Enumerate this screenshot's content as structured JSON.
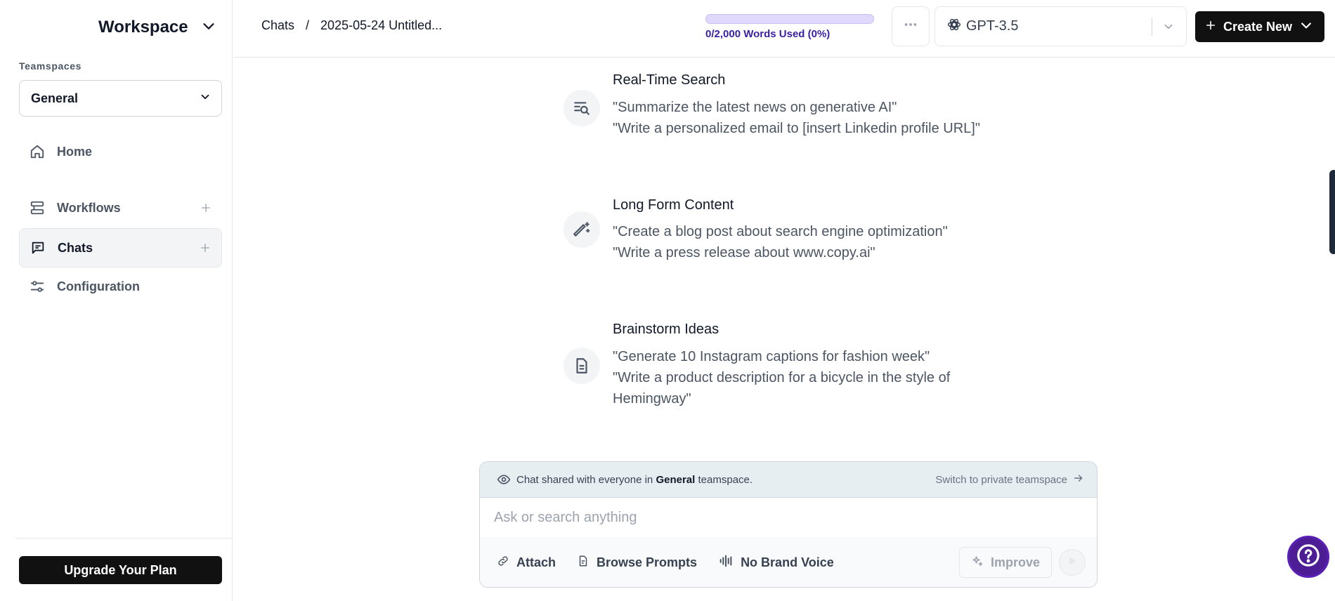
{
  "sidebar": {
    "workspace_name": "Workspace",
    "teamspaces_label": "Teamspaces",
    "teamspace_selected": "General",
    "nav": [
      {
        "label": "Home",
        "icon": "home-icon"
      },
      {
        "label": "Workflows",
        "icon": "workflows-icon"
      },
      {
        "label": "Chats",
        "icon": "chat-icon",
        "active": true
      },
      {
        "label": "Configuration",
        "icon": "sliders-icon"
      }
    ],
    "upgrade_label": "Upgrade Your Plan"
  },
  "header": {
    "breadcrumb": {
      "root": "Chats",
      "separator": "/",
      "current": "2025-05-24 Untitled..."
    },
    "usage": {
      "text": "0/2,000 Words Used (0%)",
      "percent": 0
    },
    "more_icon": "ellipsis-icon",
    "model": {
      "icon": "openai-logo-icon",
      "name": "GPT-3.5"
    },
    "create_label": "Create New"
  },
  "prompt_groups": [
    {
      "title": "Real-Time Search",
      "icon": "search-list-icon",
      "examples": [
        "\"Summarize the latest news on generative AI\"",
        "\"Write a personalized email to [insert Linkedin profile URL]\""
      ]
    },
    {
      "title": "Long Form Content",
      "icon": "magic-pen-icon",
      "examples": [
        "\"Create a blog post about search engine optimization\"",
        "\"Write a press release about www.copy.ai\""
      ]
    },
    {
      "title": "Brainstorm Ideas",
      "icon": "document-icon",
      "examples": [
        "\"Generate 10 Instagram captions for fashion week\"",
        "\"Write a product description for a bicycle in the style of Hemingway\""
      ]
    }
  ],
  "composer": {
    "share_prefix": "Chat shared with everyone in",
    "share_team": "General",
    "share_suffix": "teamspace.",
    "switch_label": "Switch to private teamspace",
    "placeholder": "Ask or search anything",
    "attach_label": "Attach",
    "browse_label": "Browse Prompts",
    "brand_voice_label": "No Brand Voice",
    "improve_label": "Improve"
  },
  "colors": {
    "accent": "#4c1d95",
    "usage_fill": "#6d28d9",
    "dark_button": "#111111"
  }
}
